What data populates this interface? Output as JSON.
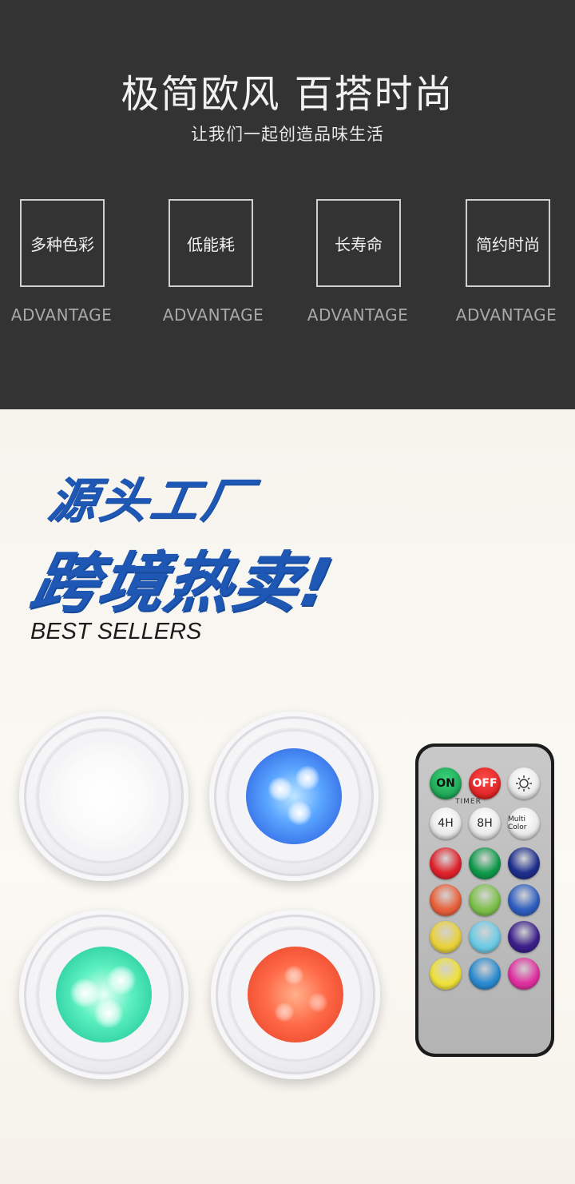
{
  "header": {
    "title": "极简欧风 百搭时尚",
    "subtitle": "让我们一起创造品味生活"
  },
  "features": [
    {
      "label": "多种色彩",
      "caption": "ADVANTAGE"
    },
    {
      "label": "低能耗",
      "caption": "ADVANTAGE"
    },
    {
      "label": "长寿命",
      "caption": "ADVANTAGE"
    },
    {
      "label": "简约时尚",
      "caption": "ADVANTAGE"
    }
  ],
  "promo": {
    "line1": "源头工厂",
    "line2": "跨境热卖!",
    "line3": "BEST SELLERS",
    "accent_color": "#1f57b4"
  },
  "lights": [
    {
      "color_name": "white",
      "hex": "#ffffff"
    },
    {
      "color_name": "blue",
      "hex": "#3f7cf0"
    },
    {
      "color_name": "green",
      "hex": "#2fe0a8"
    },
    {
      "color_name": "red",
      "hex": "#f25a3a"
    }
  ],
  "remote": {
    "on_label": "ON",
    "off_label": "OFF",
    "brightness_icon": "sun-icon",
    "timer_label": "TIMER",
    "timer_4h_label": "4H",
    "timer_8h_label": "8H",
    "multicolor_label": "Multi Color",
    "color_buttons": [
      "#e0222c",
      "#0f9a4a",
      "#1e2f8c",
      "#e8603a",
      "#7cc04a",
      "#2f5ec0",
      "#ead23a",
      "#6ccbe6",
      "#3a1f8a",
      "#f0e23a",
      "#2a8ad0",
      "#e030a0"
    ]
  }
}
